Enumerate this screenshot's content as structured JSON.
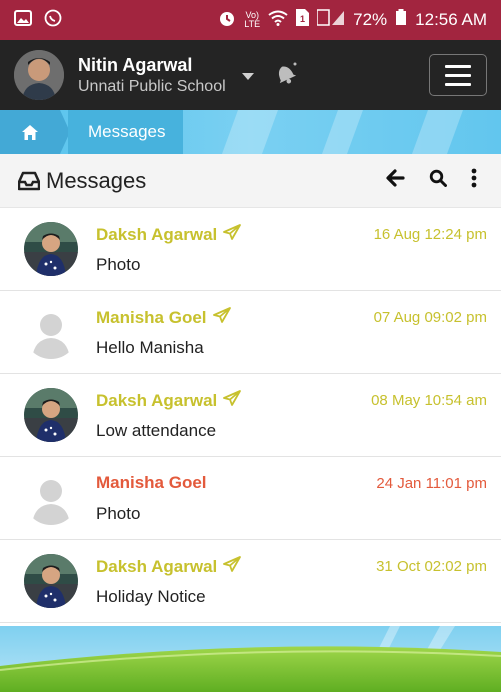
{
  "status_bar": {
    "battery": "72%",
    "time": "12:56 AM",
    "icons": [
      "gallery-icon",
      "whatsapp-icon",
      "alarm-icon",
      "volte-icon",
      "wifi-icon",
      "sim-icon",
      "signal-icon",
      "battery-icon"
    ]
  },
  "header": {
    "user_name": "Nitin Agarwal",
    "school": "Unnati Public School",
    "icons": [
      "user-avatar",
      "chevron-down-icon",
      "notification-bell-icon",
      "hamburger-menu-icon"
    ]
  },
  "breadcrumb": {
    "home_icon": "home-icon",
    "current": "Messages"
  },
  "page": {
    "title": "Messages",
    "icons": [
      "inbox-icon",
      "back-arrow-icon",
      "search-icon",
      "more-vertical-icon"
    ]
  },
  "messages": [
    {
      "sender": "Daksh Agarwal",
      "subject": "Photo",
      "time": "16 Aug 12:24 pm",
      "sent": true,
      "avatar": "child-photo"
    },
    {
      "sender": "Manisha Goel",
      "subject": "Hello Manisha",
      "time": "07 Aug 09:02 pm",
      "sent": true,
      "avatar": "placeholder-person"
    },
    {
      "sender": "Daksh Agarwal",
      "subject": "Low attendance",
      "time": "08 May 10:54 am",
      "sent": true,
      "avatar": "child-photo"
    },
    {
      "sender": "Manisha Goel",
      "subject": "Photo",
      "time": "24 Jan 11:01 pm",
      "sent": false,
      "avatar": "placeholder-person"
    },
    {
      "sender": "Daksh Agarwal",
      "subject": "Holiday Notice",
      "time": "31 Oct 02:02 pm",
      "sent": true,
      "avatar": "child-photo"
    }
  ],
  "colors": {
    "status_bar": "#a2253f",
    "top_bar": "#242424",
    "breadcrumb": "#56c2ec",
    "sent_text": "#c7c12e",
    "unread_text": "#e35a3c"
  }
}
